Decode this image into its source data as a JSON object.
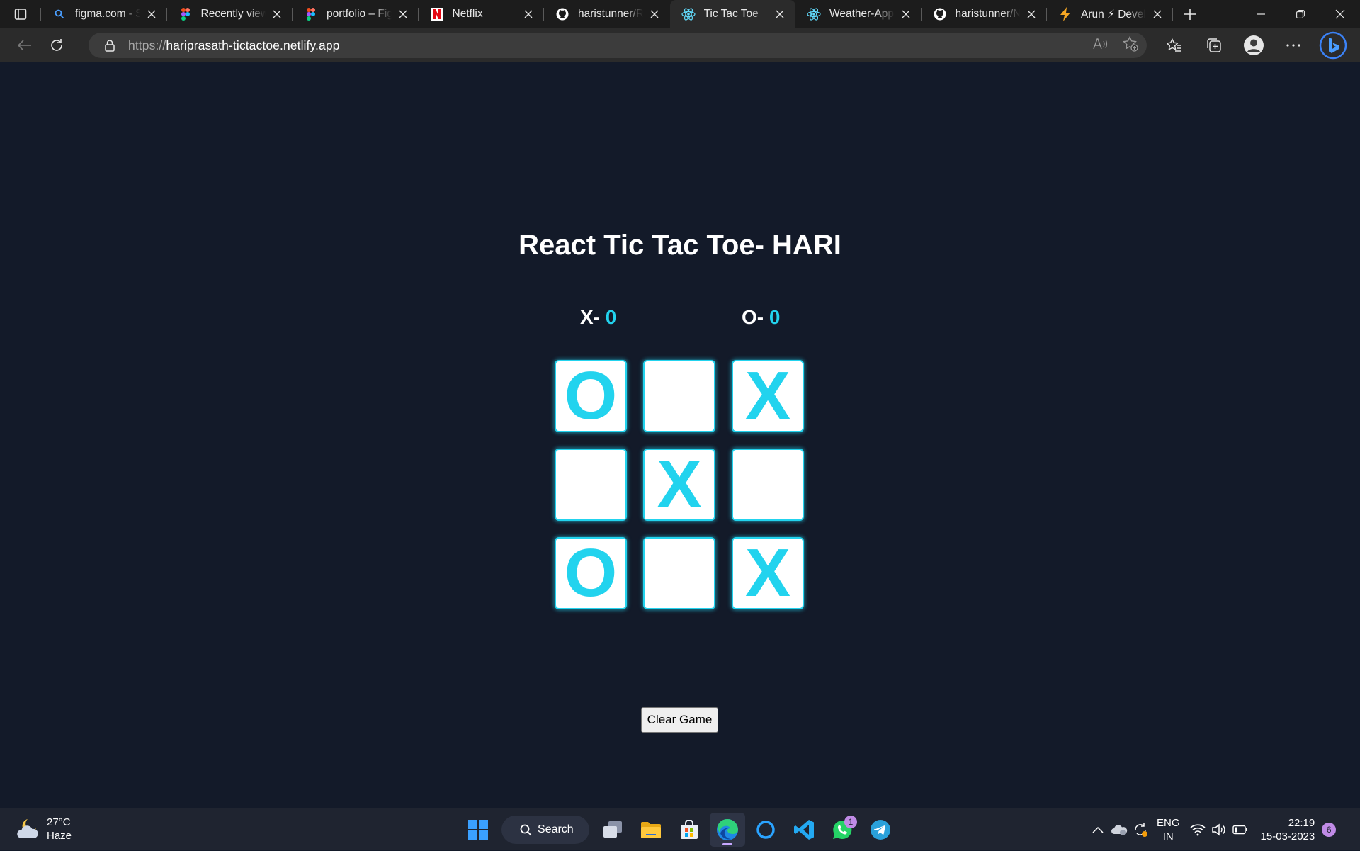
{
  "browser": {
    "tabs": [
      {
        "title": "figma.com - Search",
        "icon": "search-icon"
      },
      {
        "title": "Recently viewed",
        "icon": "figma-icon"
      },
      {
        "title": "portfolio – Figma",
        "icon": "figma-icon"
      },
      {
        "title": "Netflix",
        "icon": "netflix-icon"
      },
      {
        "title": "haristunner/React",
        "icon": "github-icon"
      },
      {
        "title": "Tic Tac Toe",
        "icon": "react-icon",
        "active": true
      },
      {
        "title": "Weather-App",
        "icon": "react-icon"
      },
      {
        "title": "haristunner/Netflix",
        "icon": "github-icon"
      },
      {
        "title": "Arun ⚡ Developer",
        "icon": "lightning-icon"
      }
    ],
    "url_protocol": "https://",
    "url_host": "hariprasath-tictactoe.netlify.app"
  },
  "game": {
    "heading": "React Tic Tac Toe- HARI",
    "score_x_label": "X-",
    "score_x_value": "0",
    "score_o_label": "O-",
    "score_o_value": "0",
    "board": [
      "O",
      "",
      "X",
      "",
      "X",
      "",
      "O",
      "",
      "X"
    ],
    "clear_label": "Clear Game",
    "accent_color": "#22d3ee",
    "background_color": "#131a29"
  },
  "taskbar": {
    "temperature": "27°C",
    "condition": "Haze",
    "search_label": "Search",
    "whatsapp_badge": "1",
    "lang_line1": "ENG",
    "lang_line2": "IN",
    "time": "22:19",
    "date": "15-03-2023",
    "notification_count": "6"
  }
}
